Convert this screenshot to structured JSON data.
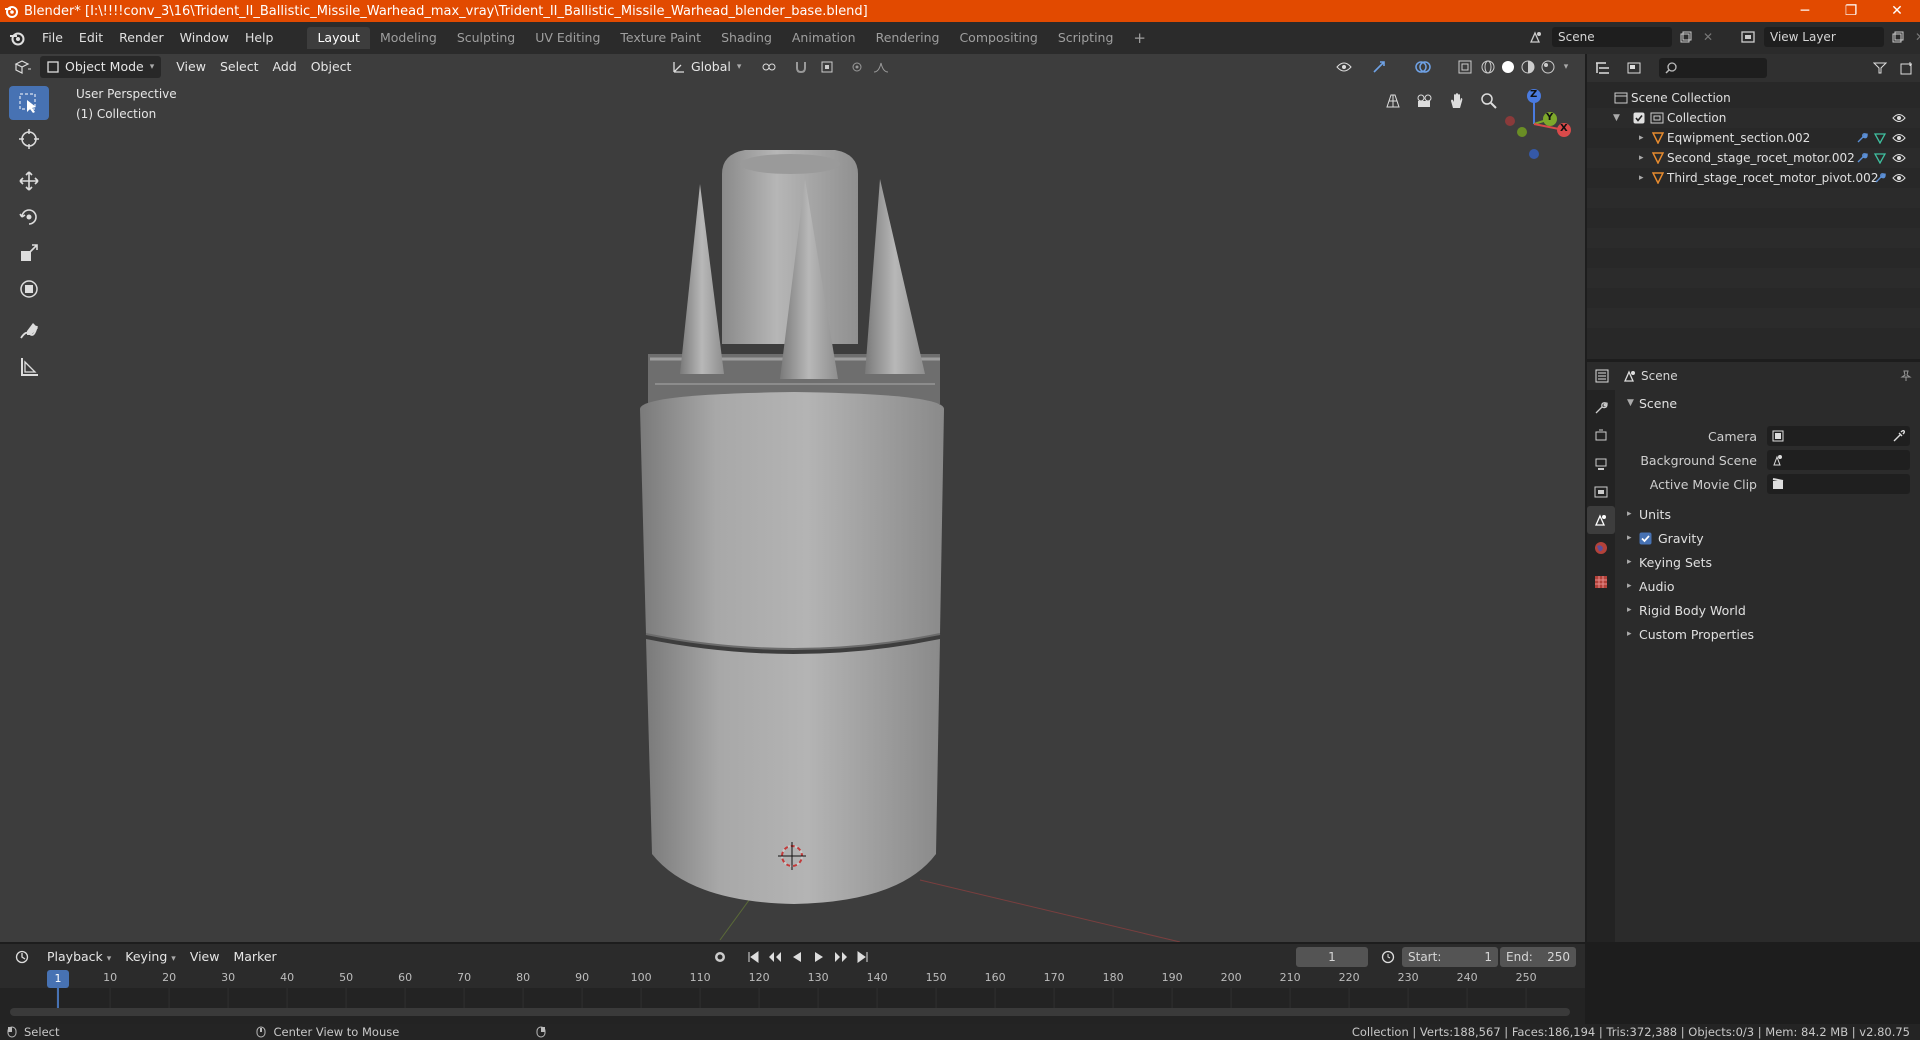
{
  "window": {
    "title": "Blender* [I:\\!!!!conv_3\\16\\Trident_II_Ballistic_Missile_Warhead_max_vray\\Trident_II_Ballistic_Missile_Warhead_blender_base.blend]",
    "minimize": "─",
    "restore": "❐",
    "close": "✕"
  },
  "menubar": {
    "items": [
      "File",
      "Edit",
      "Render",
      "Window",
      "Help"
    ],
    "workspaces": [
      "Layout",
      "Modeling",
      "Sculpting",
      "UV Editing",
      "Texture Paint",
      "Shading",
      "Animation",
      "Rendering",
      "Compositing",
      "Scripting"
    ],
    "add_tab": "+",
    "scene_label": "Scene",
    "view_layer_label": "View Layer"
  },
  "viewport_header": {
    "mode": "Object Mode",
    "menus": [
      "View",
      "Select",
      "Add",
      "Object"
    ],
    "transform_orientation": "Global"
  },
  "viewport": {
    "perspective": "User Perspective",
    "collection": "(1) Collection",
    "gizmo": {
      "z": "Z",
      "y": "Y",
      "x": "X"
    }
  },
  "outliner": {
    "root": "Scene Collection",
    "collection": "Collection",
    "objects": [
      {
        "name": "Eqwipment_section.002"
      },
      {
        "name": "Second_stage_rocet_motor.002"
      },
      {
        "name": "Third_stage_rocet_motor_pivot.002"
      }
    ]
  },
  "properties": {
    "context_label": "Scene",
    "panel_title": "Scene",
    "fields": [
      {
        "label": "Camera",
        "value": ""
      },
      {
        "label": "Background Scene",
        "value": ""
      },
      {
        "label": "Active Movie Clip",
        "value": ""
      }
    ],
    "sections": [
      {
        "label": "Units"
      },
      {
        "label": "Gravity",
        "checked": true
      },
      {
        "label": "Keying Sets"
      },
      {
        "label": "Audio"
      },
      {
        "label": "Rigid Body World"
      },
      {
        "label": "Custom Properties"
      }
    ]
  },
  "timeline": {
    "menus": [
      "Playback",
      "Keying",
      "View",
      "Marker"
    ],
    "current_frame": "1",
    "start_label": "Start:",
    "start_value": "1",
    "end_label": "End:",
    "end_value": "250",
    "ticks": [
      "1",
      "10",
      "20",
      "30",
      "40",
      "50",
      "60",
      "70",
      "80",
      "90",
      "100",
      "110",
      "120",
      "130",
      "140",
      "150",
      "160",
      "170",
      "180",
      "190",
      "200",
      "210",
      "220",
      "230",
      "240",
      "250"
    ]
  },
  "statusbar": {
    "select": "Select",
    "center_view": "Center View to Mouse",
    "stats": "Collection | Verts:188,567 | Faces:186,194 | Tris:372,388 | Objects:0/3 | Mem: 84.2 MB | v2.80.75"
  }
}
